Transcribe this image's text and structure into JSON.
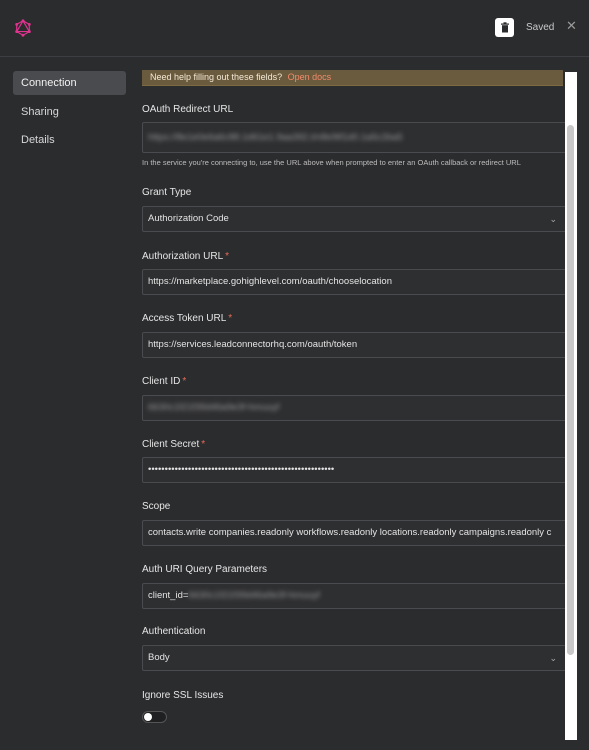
{
  "header": {
    "logo_icon": "graph-logo-icon",
    "trash_icon": "trash-icon",
    "saved_label": "Saved",
    "close_glyph": "✕",
    "accent_color": "#e0338f"
  },
  "sidebar": {
    "items": [
      {
        "label": "Connection",
        "active": true
      },
      {
        "label": "Sharing",
        "active": false
      },
      {
        "label": "Details",
        "active": false
      }
    ]
  },
  "banner": {
    "text": "Need help filling out these fields?",
    "link": "Open docs"
  },
  "fields": {
    "redirect": {
      "label": "OAuth Redirect URL",
      "value": "https://8e1e0e6a6c88.1d61e1.9aa392.t/n8e9tf1d0.1a5c2ba5",
      "help": "In the service you're connecting to, use the URL above when prompted to enter an OAuth callback or redirect URL"
    },
    "grant": {
      "label": "Grant Type",
      "value": "Authorization Code"
    },
    "auth_url": {
      "label": "Authorization URL",
      "required": "*",
      "value": "https://marketplace.gohighlevel.com/oauth/chooselocation"
    },
    "token_url": {
      "label": "Access Token URL",
      "required": "*",
      "value": "https://services.leadconnectorhq.com/oauth/token"
    },
    "client_id": {
      "label": "Client ID",
      "required": "*",
      "value": "6630c1f21f39d46a9e3f-hmuuyf"
    },
    "client_secret": {
      "label": "Client Secret",
      "required": "*",
      "value": "••••••••••••••••••••••••••••••••••••••••••••••••••••••••"
    },
    "scope": {
      "label": "Scope",
      "value": "contacts.write companies.readonly workflows.readonly locations.readonly campaigns.readonly c"
    },
    "query": {
      "label": "Auth URI Query Parameters",
      "prefix": "client_id=",
      "value": "6630c1f21f39d46a9e3f-hmuuyf"
    },
    "authentication": {
      "label": "Authentication",
      "value": "Body"
    },
    "ssl": {
      "label": "Ignore SSL Issues",
      "enabled": false
    }
  }
}
